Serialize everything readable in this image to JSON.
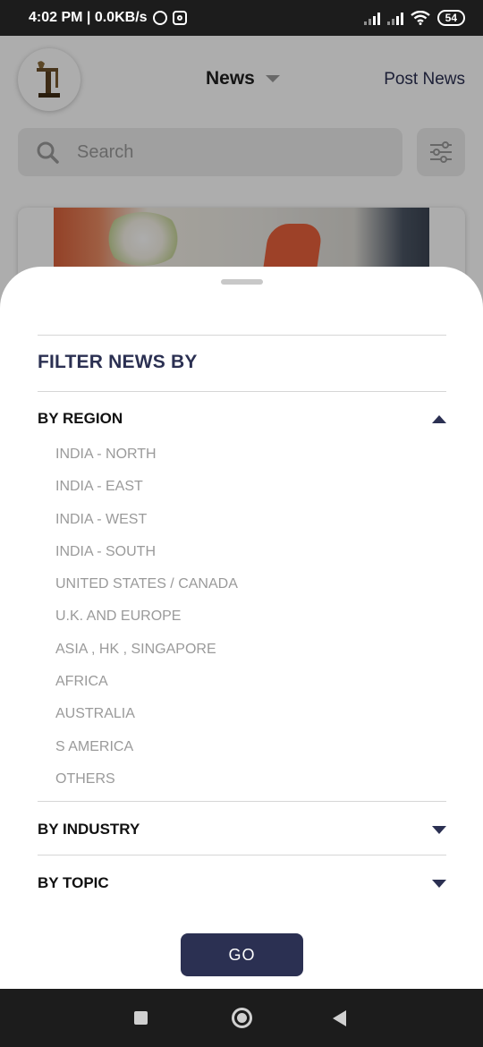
{
  "status_bar": {
    "time_speed": "4:02 PM | 0.0KB/s",
    "battery": "54"
  },
  "app_header": {
    "title": "News",
    "post_news": "Post News"
  },
  "search": {
    "placeholder": "Search"
  },
  "filter_sheet": {
    "title": "FILTER NEWS BY",
    "sections": [
      {
        "label": "BY REGION",
        "expanded": true,
        "options": [
          "INDIA - NORTH",
          "INDIA - EAST",
          "INDIA - WEST",
          "INDIA - SOUTH",
          "UNITED STATES / CANADA",
          "U.K. AND EUROPE",
          "ASIA , HK , SINGAPORE",
          "AFRICA",
          "AUSTRALIA",
          "S AMERICA",
          "OTHERS"
        ]
      },
      {
        "label": "BY INDUSTRY",
        "expanded": false
      },
      {
        "label": "BY TOPIC",
        "expanded": false
      }
    ],
    "go_label": "GO"
  },
  "colors": {
    "accent": "#2b3052",
    "option_text": "#9a9a9a"
  }
}
